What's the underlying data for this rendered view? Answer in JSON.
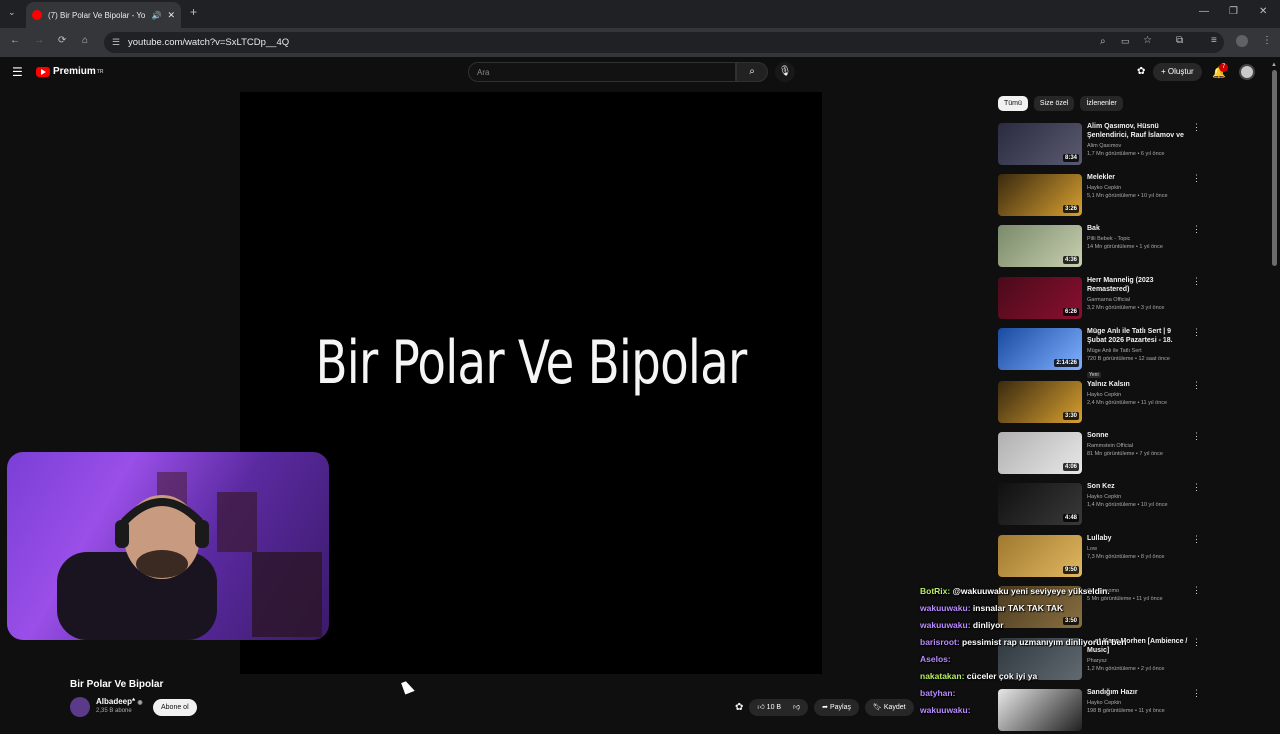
{
  "browser": {
    "tab_title": "(7) Bir Polar Ve Bipolar - Yo",
    "url": "youtube.com/watch?v=SxLTCDp__4Q"
  },
  "header": {
    "logo_text": "Premium",
    "logo_region": "TR",
    "search_placeholder": "Ara",
    "create_label": "Oluştur",
    "notification_count": "7"
  },
  "player": {
    "overlay_text": "Bir Polar Ve Bipolar"
  },
  "video": {
    "title": "Bir Polar Ve Bipolar",
    "channel": "Albadeep*",
    "subscribers": "2,35 B abone",
    "subscribe_label": "Abone ol",
    "likes": "10 B",
    "share_label": "Paylaş",
    "save_label": "Kaydet"
  },
  "chips": [
    "Tümü",
    "Size özel",
    "İzlenenler"
  ],
  "recommendations": [
    {
      "title": "Alim Qasımov, Hüsnü Şenlendirici, Rauf İslamov ve ...",
      "channel": "Alim Qasımov",
      "stats": "1,7 Mn görüntüleme • 6 yıl önce",
      "duration": "8:34",
      "colors": [
        "#2a2a40",
        "#5a5a70"
      ]
    },
    {
      "title": "Melekler",
      "channel": "Hayko Cepkin",
      "stats": "5,1 Mn görüntüleme • 10 yıl önce",
      "duration": "3:26",
      "colors": [
        "#3a2a10",
        "#d8a030"
      ]
    },
    {
      "title": "Bak",
      "channel": "Pilli Bebek - Topic",
      "stats": "14 Mn görüntüleme • 1 yıl önce",
      "duration": "4:36",
      "colors": [
        "#7a8a6a",
        "#c8d0b0"
      ]
    },
    {
      "title": "Herr Mannelig (2023 Remastered)",
      "channel": "Garmarna Official",
      "stats": "3,2 Mn görüntüleme • 3 yıl önce",
      "duration": "6:26",
      "colors": [
        "#4a0a1a",
        "#8a1030"
      ]
    },
    {
      "title": "Müge Anlı ile Tatlı Sert | 9 Şubat 2026 Pazartesi - 18. Sezon",
      "channel": "Müge Anlı ile Tatlı Sert",
      "stats": "720 B görüntüleme • 12 saat önce",
      "badge": "Yeni",
      "duration": "2:14:26",
      "colors": [
        "#1a4aa0",
        "#80b0ff"
      ]
    },
    {
      "title": "Yalnız Kalsın",
      "channel": "Hayko Cepkin",
      "stats": "2,4 Mn görüntüleme • 11 yıl önce",
      "duration": "3:30",
      "colors": [
        "#3a2a10",
        "#d8a030"
      ]
    },
    {
      "title": "Sonne",
      "channel": "Rammstein Official",
      "stats": "81 Mn görüntüleme • 7 yıl önce",
      "duration": "4:06",
      "colors": [
        "#b0b0b0",
        "#e8e8e8"
      ]
    },
    {
      "title": "Son Kez",
      "channel": "Hayko Cepkin",
      "stats": "1,4 Mn görüntüleme • 10 yıl önce",
      "duration": "4:48",
      "colors": [
        "#101010",
        "#3a3a3a"
      ]
    },
    {
      "title": "Lullaby",
      "channel": "Low",
      "stats": "7,3 Mn görüntüleme • 8 yıl önce",
      "duration": "9:50",
      "colors": [
        "#a07830",
        "#e0b860"
      ]
    },
    {
      "title": "",
      "channel": "Can Bonomo",
      "stats": "5 Mn görüntüleme • 11 yıl önce",
      "duration": "3:50",
      "colors": [
        "#4a3a20",
        "#8a7040"
      ]
    },
    {
      "title": "... at Kaer Morhen [Ambience / Music]",
      "channel": "Pharysz",
      "stats": "1,2 Mn görüntüleme • 2 yıl önce",
      "duration": "",
      "colors": [
        "#303840",
        "#606a70"
      ]
    },
    {
      "title": "Sandığım Hazır",
      "channel": "Hayko Cepkin",
      "stats": "198 B görüntüleme • 11 yıl önce",
      "duration": "",
      "colors": [
        "#e8e8e8",
        "#202020"
      ]
    }
  ],
  "chat": [
    {
      "user": "BotRix:",
      "message": "@wakuuwaku yeni seviyeye yükseldin.",
      "color": "green"
    },
    {
      "user": "wakuuwaku:",
      "message": "insnalar TAK TAK TAK",
      "color": "purple"
    },
    {
      "user": "wakuuwaku:",
      "message": "dinliyor",
      "color": "purple"
    },
    {
      "user": "barisroot:",
      "message": "pessimist rap uzmanıyım dinliyorum ben",
      "color": "purple"
    },
    {
      "user": "Aselos:",
      "message": "",
      "color": "purple"
    },
    {
      "user": "nakatakan:",
      "message": "cüceler çok iyi ya",
      "color": "green"
    },
    {
      "user": "batyhan:",
      "message": "",
      "color": "purple"
    },
    {
      "user": "wakuuwaku:",
      "message": "",
      "color": "purple"
    }
  ]
}
